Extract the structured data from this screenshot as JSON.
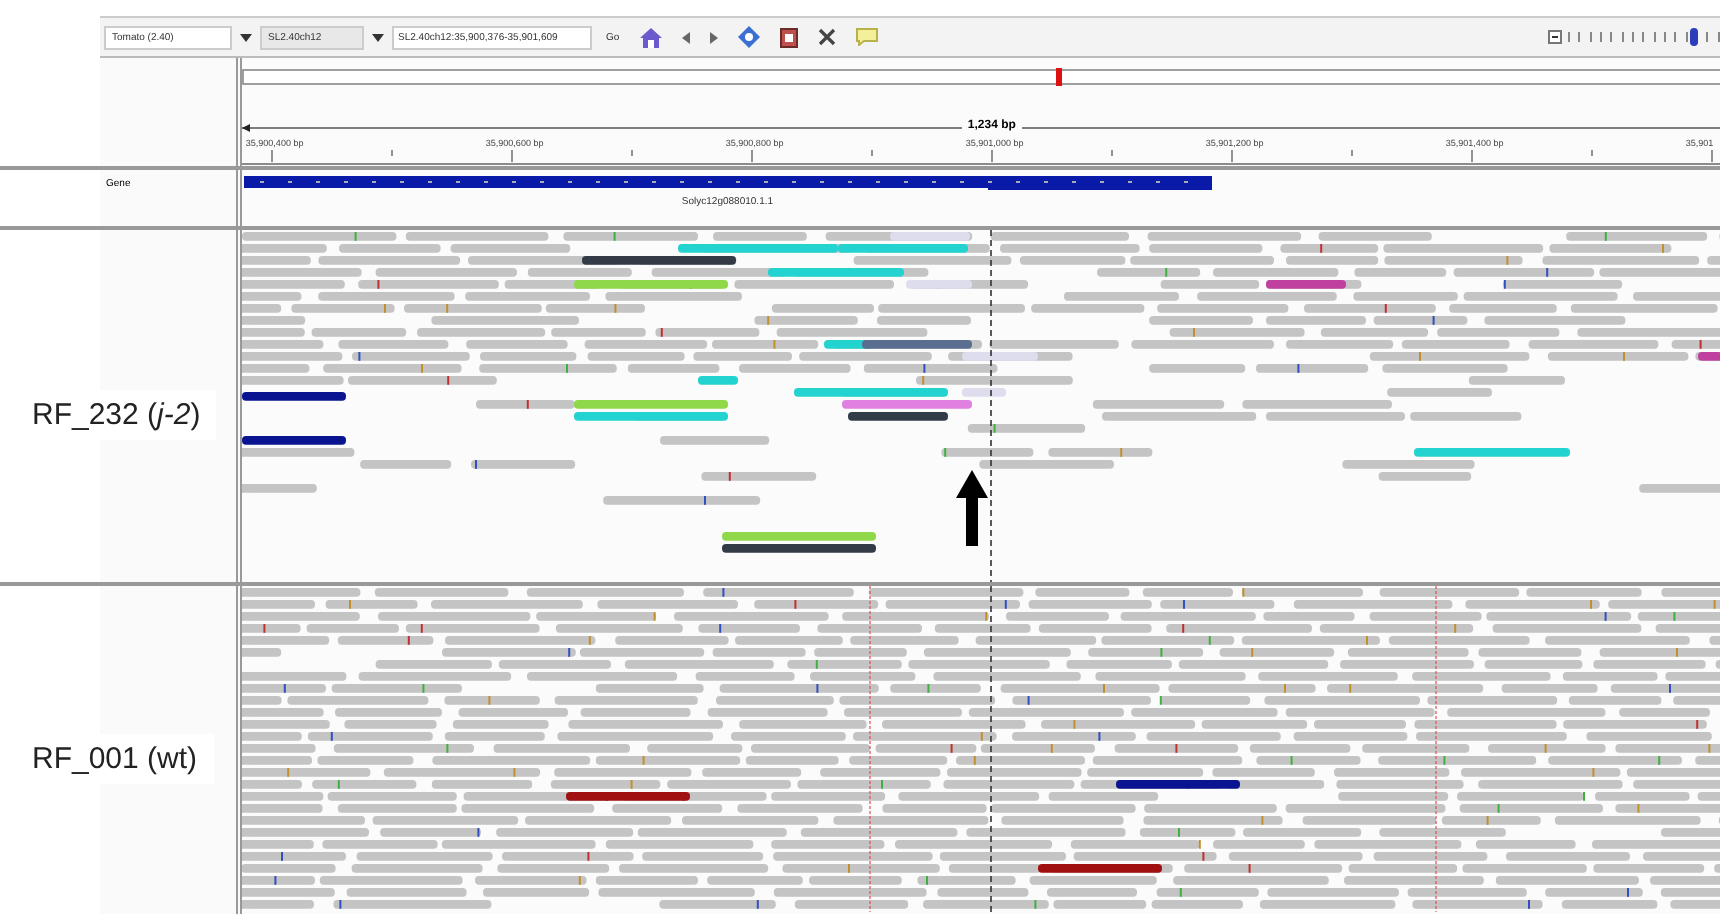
{
  "toolbar": {
    "genome": "Tomato (2.40)",
    "chromosome": "SL2.40ch12",
    "locus": "SL2.40ch12:35,900,376-35,901,609",
    "go": "Go"
  },
  "zoom": {
    "level": 0.8
  },
  "ruler": {
    "span": "1,234 bp",
    "ticks": [
      "35,900,400 bp",
      "35,900,600 bp",
      "35,900,800 bp",
      "35,901,000 bp",
      "35,901,200 bp",
      "35,901,400 bp",
      "35,901"
    ]
  },
  "gene_track": {
    "name": "Gene",
    "feature": "Solyc12g088010.1.1"
  },
  "tracks": [
    {
      "label": "RF_232 (*j-2*)",
      "kind": "sparse"
    },
    {
      "label": "RF_001 (wt)",
      "kind": "dense"
    }
  ]
}
